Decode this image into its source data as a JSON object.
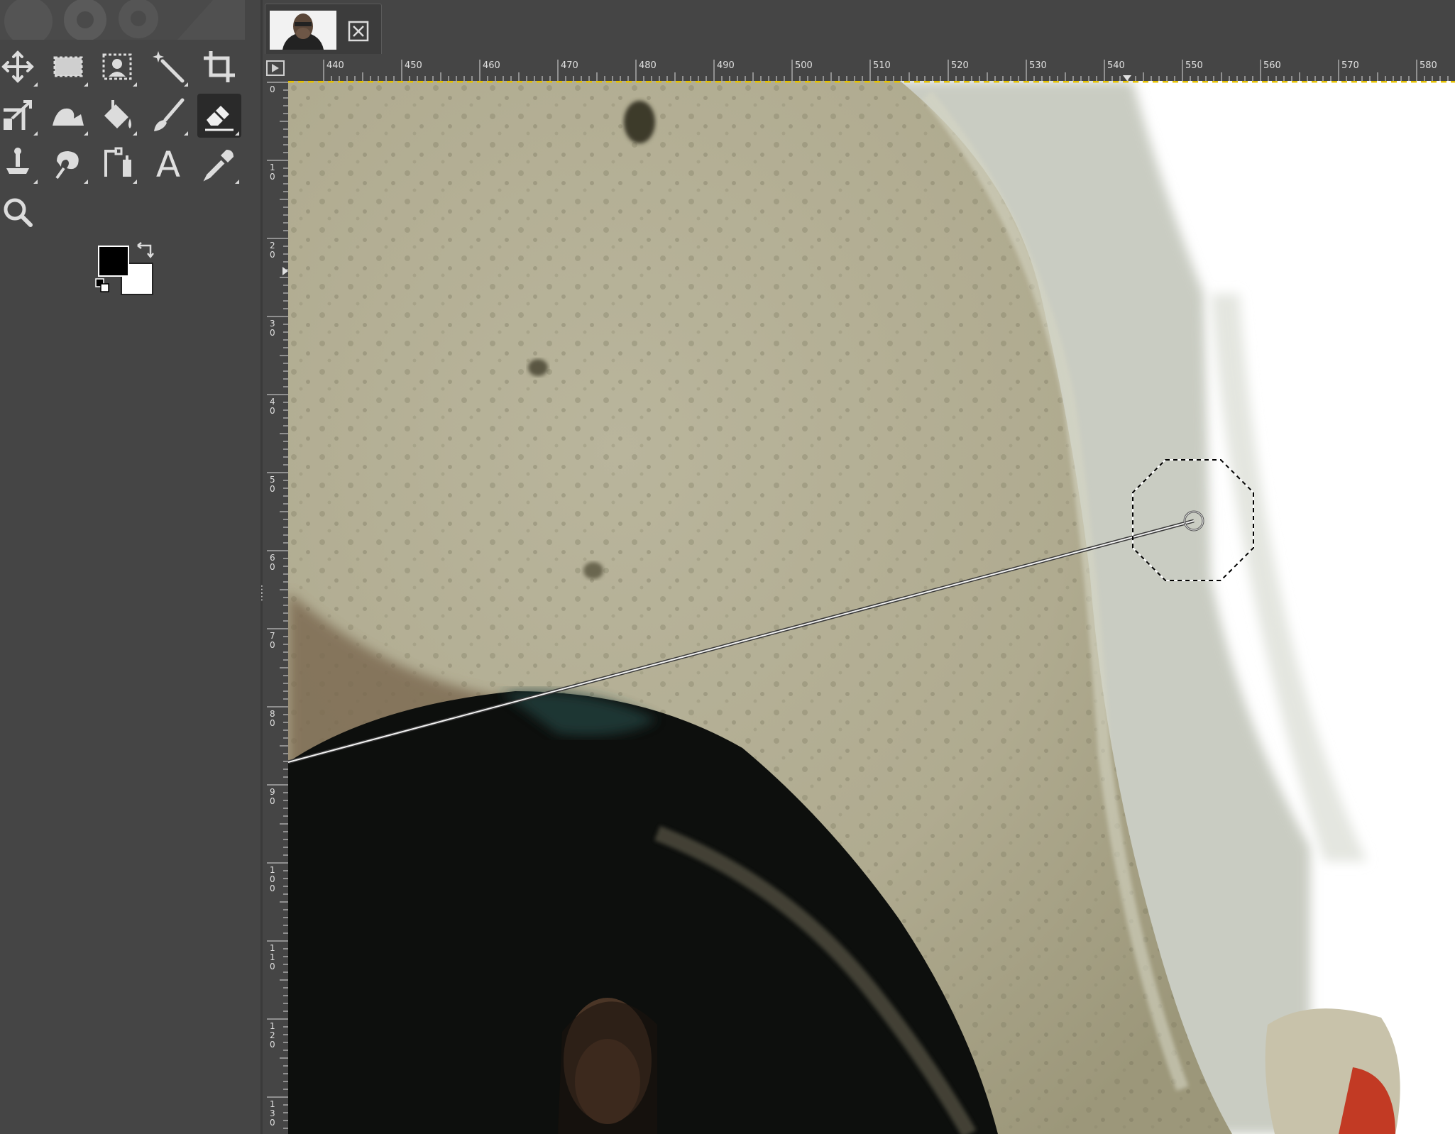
{
  "toolbox": {
    "tools": [
      {
        "name": "move-tool",
        "icon": "move-icon",
        "active": false
      },
      {
        "name": "rect-select-tool",
        "icon": "rect-select-icon",
        "active": false
      },
      {
        "name": "foreground-select-tool",
        "icon": "foreground-select-icon",
        "active": false
      },
      {
        "name": "fuzzy-select-tool",
        "icon": "magic-wand-icon",
        "active": false
      },
      {
        "name": "crop-tool",
        "icon": "crop-icon",
        "active": false
      },
      {
        "name": "unified-transform-tool",
        "icon": "transform-icon",
        "active": false
      },
      {
        "name": "warp-transform-tool",
        "icon": "warp-icon",
        "active": false
      },
      {
        "name": "bucket-fill-tool",
        "icon": "bucket-fill-icon",
        "active": false
      },
      {
        "name": "paintbrush-tool",
        "icon": "paintbrush-icon",
        "active": false
      },
      {
        "name": "eraser-tool",
        "icon": "eraser-icon",
        "active": true
      },
      {
        "name": "clone-tool",
        "icon": "clone-stamp-icon",
        "active": false
      },
      {
        "name": "smudge-tool",
        "icon": "smudge-icon",
        "active": false
      },
      {
        "name": "paths-tool",
        "icon": "paths-icon",
        "active": false
      },
      {
        "name": "text-tool",
        "icon": "text-icon",
        "label": "A",
        "active": false
      },
      {
        "name": "color-picker-tool",
        "icon": "color-picker-icon",
        "active": false
      },
      {
        "name": "zoom-tool",
        "icon": "zoom-icon",
        "active": false
      }
    ],
    "foreground_color": "#000000",
    "background_color": "#ffffff"
  },
  "image_tabs": [
    {
      "thumbnail": "portrait-thumbnail",
      "close_icon": "close-icon"
    }
  ],
  "rulers": {
    "horizontal": [
      "440",
      "450",
      "460",
      "470",
      "480",
      "490",
      "500",
      "510",
      "520",
      "530",
      "540",
      "550",
      "560",
      "570",
      "580"
    ],
    "vertical": [
      "0",
      "10",
      "20",
      "30",
      "40",
      "50",
      "60",
      "70",
      "80",
      "90",
      "100",
      "110",
      "120",
      "130"
    ]
  },
  "canvas": {
    "active_tool": "eraser",
    "brush_outline": "octagon-brush-outline",
    "line_preview": "line-preview"
  }
}
